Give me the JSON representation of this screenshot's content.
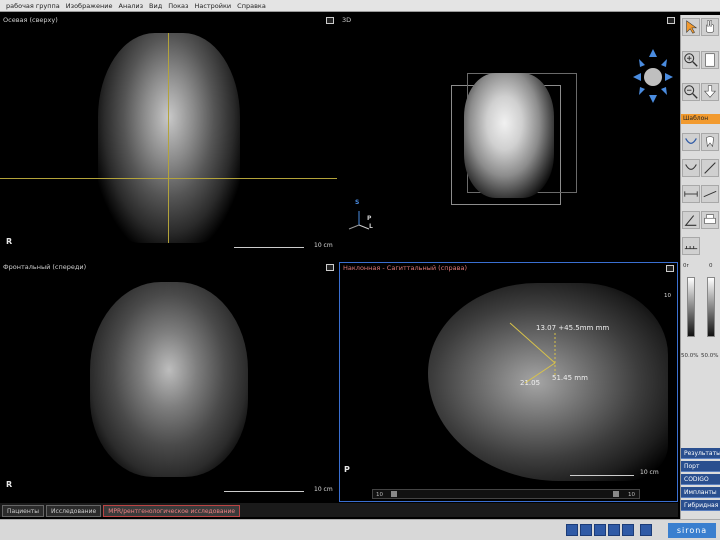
{
  "menu": [
    "рабочая группа",
    "Изображение",
    "Анализ",
    "Вид",
    "Показ",
    "Настройки",
    "Справка"
  ],
  "viewports": {
    "top_left": {
      "title": "Осевая (сверху)",
      "orient_label": "R",
      "scale": "10 cm"
    },
    "top_right": {
      "title": "3D",
      "axis_s": "S",
      "axis_p": "P",
      "axis_l": "L"
    },
    "bottom_left": {
      "title": "Фронтальный (спереди)",
      "orient_label": "R",
      "scale": "10 cm"
    },
    "bottom_right": {
      "title": "Наклонная - Сагиттальный (справа)",
      "orient_label": "P",
      "scale": "10 cm",
      "measure_1": "13.07 +45.5mm mm",
      "measure_2": "21.05",
      "measure_3": "51.45 mm",
      "range_left": "10",
      "range_right": "10"
    }
  },
  "right_panel": {
    "section_label": "Шаблон",
    "slider_left_top": "0r",
    "slider_right_top": "0",
    "slider_left_bottom": "50.0%",
    "slider_right_bottom": "50.0%",
    "buttons": [
      "Результаты",
      "Порт",
      "CODIGO",
      "Импланты",
      "Гибридная"
    ]
  },
  "tabs": [
    "Пациенты",
    "Исследование",
    "MPR/рентгенологическое исследование"
  ],
  "status": {
    "logo": "sirona"
  },
  "colors": {
    "accent": "#f29a2e",
    "selection": "#3a6fd1",
    "crosshair": "#b3a33a",
    "button": "#2a4f8f"
  }
}
